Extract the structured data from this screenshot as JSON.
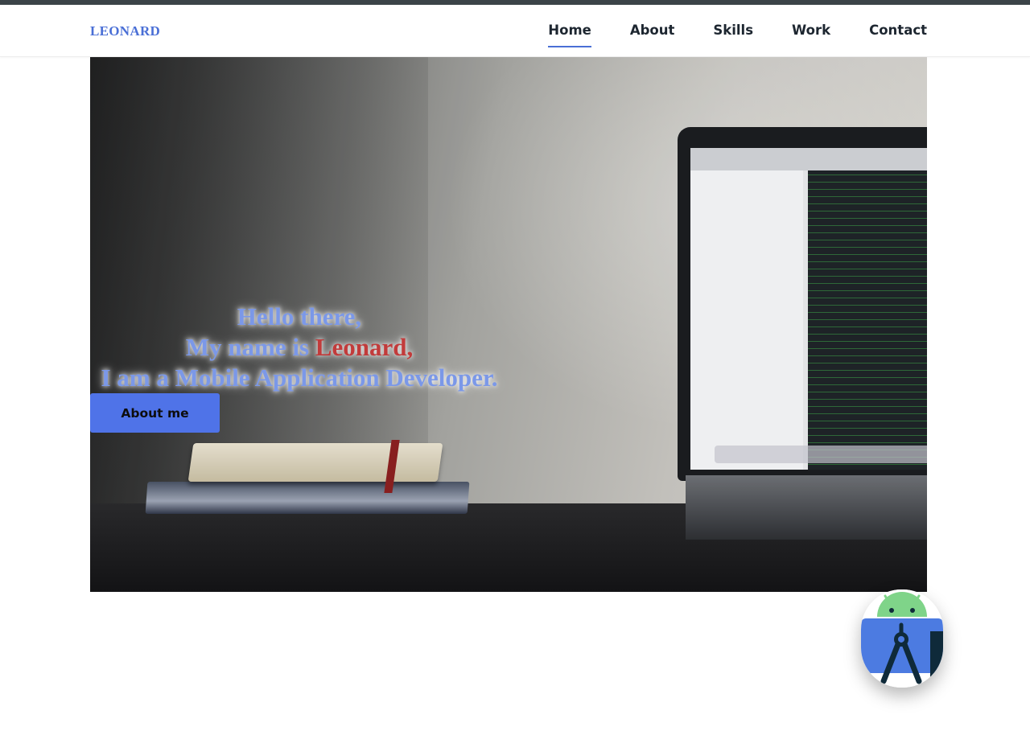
{
  "brand": {
    "logo_text": "LEONARD"
  },
  "nav": {
    "items": [
      {
        "label": "Home",
        "active": true
      },
      {
        "label": "About",
        "active": false
      },
      {
        "label": "Skills",
        "active": false
      },
      {
        "label": "Work",
        "active": false
      },
      {
        "label": "Contact",
        "active": false
      }
    ]
  },
  "hero": {
    "line1": "Hello there,",
    "line2_prefix": "My name is ",
    "line2_name": "Leonard,",
    "line3": "I am a Mobile Application Developer.",
    "button_label": "About me"
  },
  "floating_action": {
    "icon": "android-studio-icon"
  },
  "colors": {
    "accent": "#4a6fd6",
    "button": "#4f73e8",
    "name_highlight": "#c23b3b",
    "topbar": "#3b4448"
  }
}
